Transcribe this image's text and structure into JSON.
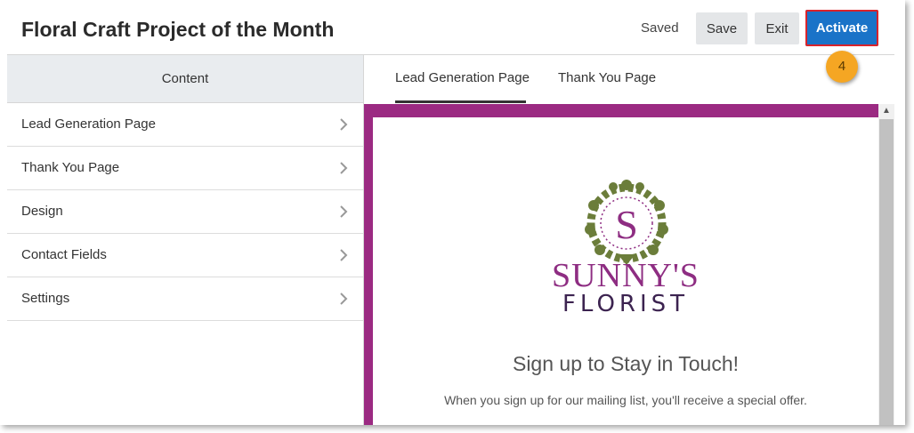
{
  "header": {
    "title": "Floral Craft Project of the Month",
    "status": "Saved",
    "save_label": "Save",
    "exit_label": "Exit",
    "activate_label": "Activate",
    "step_number": "4"
  },
  "sidebar": {
    "heading": "Content",
    "items": [
      {
        "label": "Lead Generation Page",
        "icon": "chevron-right-icon"
      },
      {
        "label": "Thank You Page",
        "icon": "chevron-right-icon"
      },
      {
        "label": "Design",
        "icon": "chevron-right-icon"
      },
      {
        "label": "Contact Fields",
        "icon": "chevron-right-icon"
      },
      {
        "label": "Settings",
        "icon": "chevron-right-icon"
      }
    ]
  },
  "tabs": [
    {
      "label": "Lead Generation Page",
      "active": true
    },
    {
      "label": "Thank You Page",
      "active": false
    }
  ],
  "preview": {
    "logo": {
      "monogram": "S",
      "brand_name": "SUNNY'S",
      "brand_sub": "FLORIST"
    },
    "heading": "Sign up to Stay in Touch!",
    "body": "When you sign up for our mailing list, you'll receive a special offer."
  },
  "colors": {
    "accent": "#1a73c8",
    "highlight": "#d9232b",
    "badge": "#f5a623",
    "preview_border": "#9b2a82",
    "logo_green": "#6b7d3a",
    "logo_purple": "#8e2d82"
  }
}
